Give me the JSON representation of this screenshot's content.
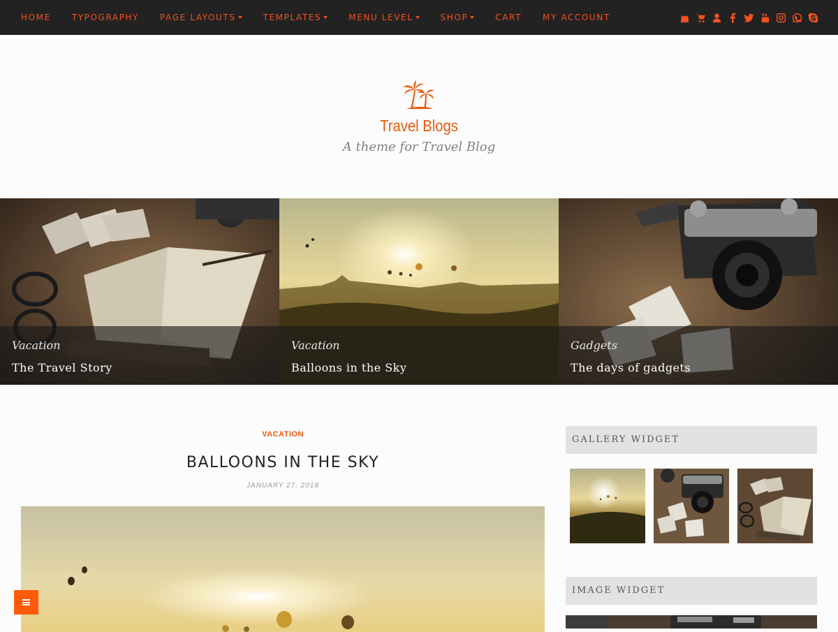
{
  "nav": {
    "items": [
      {
        "label": "HOME",
        "dropdown": false
      },
      {
        "label": "TYPOGRAPHY",
        "dropdown": false
      },
      {
        "label": "PAGE LAYOUTS",
        "dropdown": true
      },
      {
        "label": "TEMPLATES",
        "dropdown": true
      },
      {
        "label": "MENU LEVEL",
        "dropdown": true
      },
      {
        "label": "SHOP",
        "dropdown": true
      },
      {
        "label": "CART",
        "dropdown": false
      },
      {
        "label": "MY ACCOUNT",
        "dropdown": false
      }
    ],
    "social_icons": [
      "shopping-bag-icon",
      "cart-icon",
      "user-icon",
      "facebook-icon",
      "twitter-icon",
      "youtube-icon",
      "instagram-icon",
      "whatsapp-icon",
      "skype-icon"
    ],
    "accent_color": "#f4511e"
  },
  "header": {
    "site_title": "Travel Blogs",
    "tagline": "A theme for Travel Blog",
    "logo_icon": "palm-trees-icon"
  },
  "slides": [
    {
      "category": "Vacation",
      "title": "The Travel Story"
    },
    {
      "category": "Vacation",
      "title": "Balloons in the Sky"
    },
    {
      "category": "Gadgets",
      "title": "The days of gadgets"
    }
  ],
  "post": {
    "category": "VACATION",
    "title": "BALLOONS IN THE SKY",
    "date": "JANUARY 27, 2018"
  },
  "sidebar": {
    "gallery_title": "GALLERY WIDGET",
    "image_widget_title": "IMAGE WIDGET"
  },
  "menu_toggle_icon": "hamburger-icon"
}
